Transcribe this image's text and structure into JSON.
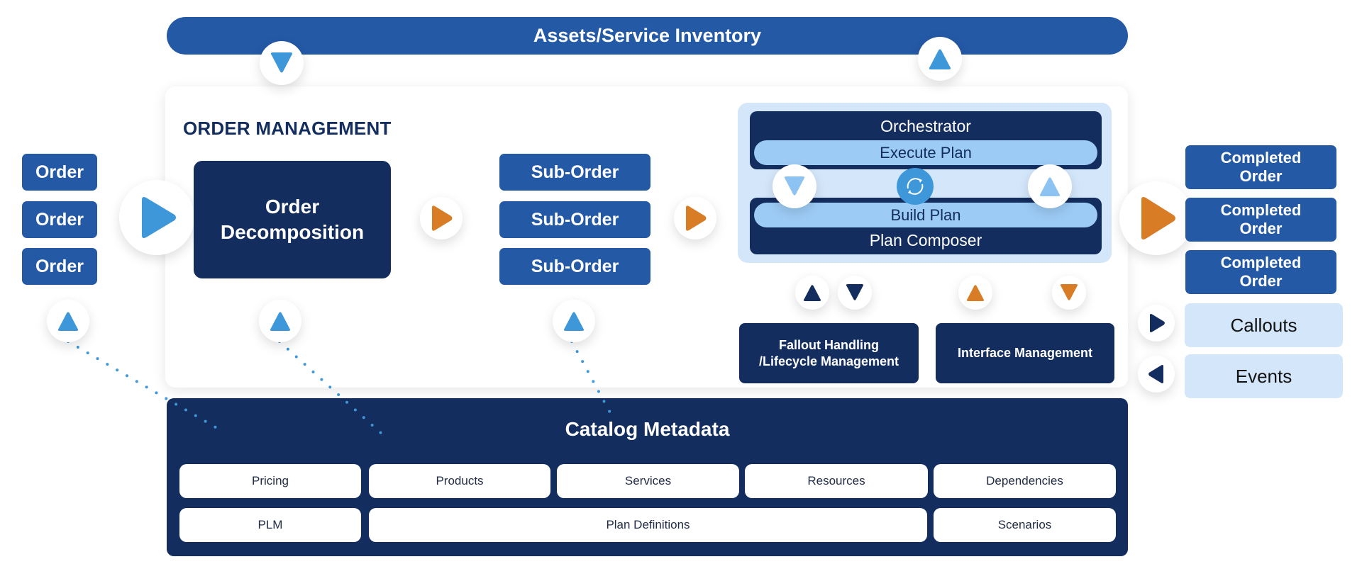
{
  "inventory": {
    "label": "Assets/Service Inventory"
  },
  "order_management": {
    "title": "ORDER MANAGEMENT"
  },
  "orders": [
    "Order",
    "Order",
    "Order"
  ],
  "decomposition": {
    "line1": "Order",
    "line2": "Decomposition"
  },
  "sub_orders": [
    "Sub-Order",
    "Sub-Order",
    "Sub-Order"
  ],
  "orchestrator": {
    "title": "Orchestrator",
    "execute": "Execute Plan",
    "build": "Build Plan",
    "composer": "Plan Composer",
    "sync_icon": "sync-icon"
  },
  "management": {
    "fallout_line1": "Fallout Handling",
    "fallout_line2": "/Lifecycle Management",
    "interface": "Interface Management"
  },
  "completed_orders": [
    {
      "line1": "Completed",
      "line2": "Order"
    },
    {
      "line1": "Completed",
      "line2": "Order"
    },
    {
      "line1": "Completed",
      "line2": "Order"
    }
  ],
  "callouts": {
    "label": "Callouts"
  },
  "events": {
    "label": "Events"
  },
  "catalog": {
    "title": "Catalog Metadata",
    "row1": [
      "Pricing",
      "Products",
      "Services",
      "Resources",
      "Dependencies"
    ],
    "row2": [
      "PLM",
      "Plan Definitions",
      "Scenarios"
    ]
  },
  "colors": {
    "dark_navy": "#132d5e",
    "medium_blue": "#2459a6",
    "light_blue": "#d4e6fa",
    "pill_blue": "#9ccbf5",
    "arrow_blue": "#3d97d9",
    "arrow_orange": "#d87c25"
  }
}
